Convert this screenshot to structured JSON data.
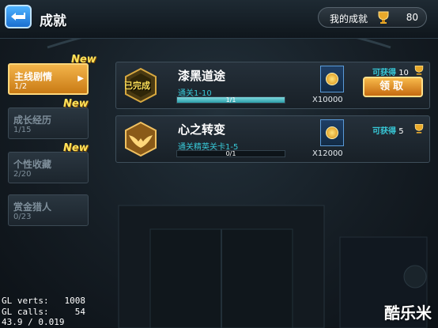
{
  "header": {
    "title": "成就",
    "my_achievements_label": "我的成就",
    "my_achievements_value": "80"
  },
  "sidebar": {
    "items": [
      {
        "name": "主线剧情",
        "count": "1/2",
        "new": "New",
        "active": true
      },
      {
        "name": "成长经历",
        "count": "1/15",
        "new": "New",
        "active": false
      },
      {
        "name": "个性收藏",
        "count": "2/20",
        "new": "New",
        "active": false
      },
      {
        "name": "赏金猎人",
        "count": "0/23",
        "new": "",
        "active": false
      }
    ]
  },
  "quests": [
    {
      "badge_text": "已完成",
      "name": "漆黑道途",
      "condition": "通关1-10",
      "progress_text": "1/1",
      "progress": 1.0,
      "reward_amount": "X10000",
      "available_label": "可获得",
      "available_value": "10",
      "claim_label": "领取"
    },
    {
      "name": "心之转变",
      "condition": "通关精英关卡1-5",
      "progress_text": "0/1",
      "progress": 0.0,
      "reward_amount": "X12000",
      "available_label": "可获得",
      "available_value": "5"
    }
  ],
  "debug": {
    "verts_line": "GL verts:   1008",
    "calls_line": "GL calls:     54",
    "fps_line": "43.9 / 0.019"
  },
  "watermark": "酷乐米",
  "colors": {
    "accent_orange": "#f3b44a",
    "teal_text": "#38c9d8",
    "gold": "#ffe25a"
  }
}
